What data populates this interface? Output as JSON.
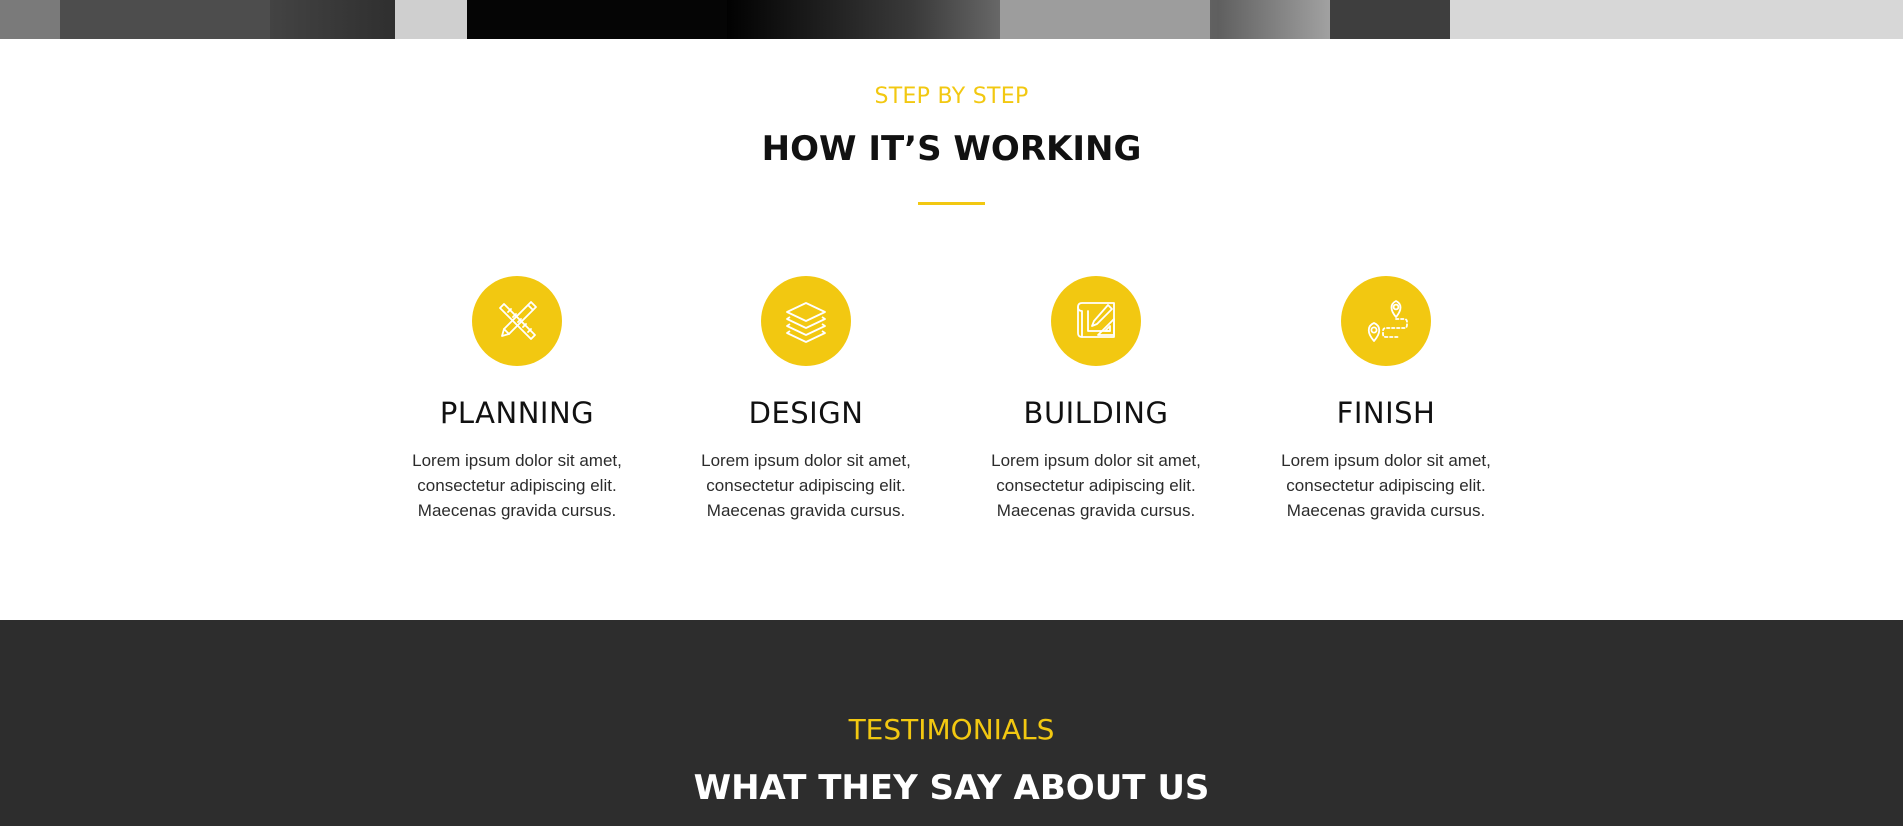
{
  "how_section": {
    "eyebrow": "STEP BY STEP",
    "title": "HOW IT’S WORKING",
    "accent_color": "#f2c811",
    "steps": [
      {
        "icon": "pencil-ruler-icon",
        "title": "PLANNING",
        "text": "Lorem ipsum dolor sit amet, consectetur adipiscing elit. Maecenas gravida cursus."
      },
      {
        "icon": "layers-icon",
        "title": "DESIGN",
        "text": "Lorem ipsum dolor sit amet, consectetur adipiscing elit. Maecenas gravida cursus."
      },
      {
        "icon": "blueprint-icon",
        "title": "BUILDING",
        "text": "Lorem ipsum dolor sit amet, consectetur adipiscing elit. Maecenas gravida cursus."
      },
      {
        "icon": "route-pins-icon",
        "title": "FINISH",
        "text": "Lorem ipsum dolor sit amet, consectetur adipiscing elit. Maecenas gravida cursus."
      }
    ]
  },
  "testimonials": {
    "eyebrow": "TESTIMONIALS",
    "title": "WHAT THEY SAY ABOUT US",
    "background_color": "#2d2d2d"
  }
}
